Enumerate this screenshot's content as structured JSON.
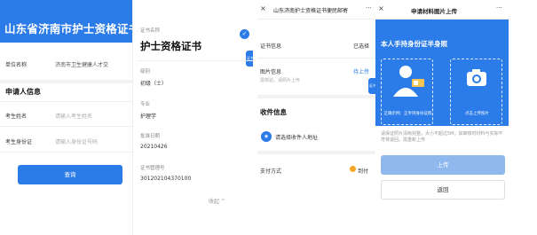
{
  "colors": {
    "primary": "#2b7ce8",
    "primary_light": "#8fb8ef",
    "accent_orange": "#f5a623"
  },
  "panel1": {
    "title": "山东省济南市护士资格证书",
    "unit_label": "单位名称",
    "unit_value": "济南市卫生健康人才交",
    "applicant_section": "申请人信息",
    "name_label": "考生姓名",
    "name_placeholder": "请输入考生姓名",
    "id_label": "考生身份证",
    "id_placeholder": "请输入身份证号码",
    "query_button": "查询"
  },
  "panel2": {
    "cert_name_label": "证书名称",
    "cert_name": "护士资格证书",
    "level_label": "级别",
    "level_value": "初级（士）",
    "major_label": "专业",
    "major_value": "护理学",
    "approve_date_label": "批准日期",
    "approve_date_value": "20210426",
    "manage_no_label": "证书管理号",
    "manage_no_value": "301202104370100",
    "collapse_label": "收起 ^",
    "side_tab": "证书"
  },
  "panel3": {
    "top_title": "山东济南护士资格证书便民邮寄",
    "close_icon": "×",
    "more_icon": "···",
    "cert_info_label": "证书信息",
    "cert_info_value": "已选择",
    "photo_info_label": "图片信息",
    "photo_info_sub": "需核验，请照片上传",
    "photo_info_value": "待上传",
    "receive_section": "收件信息",
    "address_prompt": "请选择收件人地址",
    "pay_label": "支付方式",
    "pay_value": "到付",
    "side_tab": "证书"
  },
  "panel4": {
    "top_title": "申请材料图片上传",
    "close_icon": "×",
    "more_icon": "···",
    "heading": "本人手持身份证半身照",
    "example_label": "正确示例：正手持身份证照",
    "upload_label": "点击上传照片",
    "note": "请保证照片清晰完整，大小不超过5M；如审核时材料与实际不符将退回，需重新上传",
    "upload_button": "上传",
    "back_button": "返回"
  }
}
